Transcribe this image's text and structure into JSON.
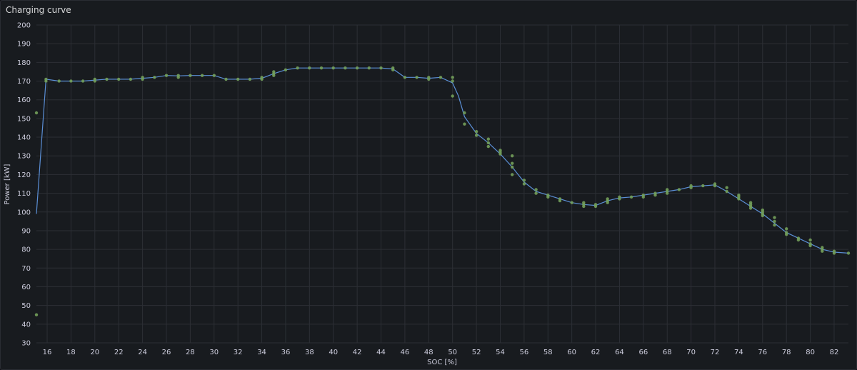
{
  "panel": {
    "title": "Charging curve"
  },
  "colors": {
    "line": "#5b8fd6",
    "points": "#73a05a",
    "grid": "#2c2f35",
    "text": "#ccccdc"
  },
  "chart_data": {
    "type": "scatter",
    "title": "Charging curve",
    "xlabel": "SOC [%]",
    "ylabel": "Power [kW]",
    "xlim": [
      15.1,
      83.2
    ],
    "ylim": [
      30,
      200
    ],
    "xticks": [
      16,
      18,
      20,
      22,
      24,
      26,
      28,
      30,
      32,
      34,
      36,
      38,
      40,
      42,
      44,
      46,
      48,
      50,
      52,
      54,
      56,
      58,
      60,
      62,
      64,
      66,
      68,
      70,
      72,
      74,
      76,
      78,
      80,
      82
    ],
    "yticks": [
      30,
      40,
      50,
      60,
      70,
      80,
      90,
      100,
      110,
      120,
      130,
      140,
      150,
      160,
      170,
      180,
      190,
      200
    ],
    "grid": true,
    "series": [
      {
        "type": "line",
        "points": [
          [
            15.1,
            99
          ],
          [
            15.9,
            171
          ],
          [
            17,
            170
          ],
          [
            18,
            170
          ],
          [
            19,
            170
          ],
          [
            20,
            170.5
          ],
          [
            21,
            171
          ],
          [
            22,
            171
          ],
          [
            23,
            171
          ],
          [
            24,
            171.5
          ],
          [
            25,
            172
          ],
          [
            26,
            173
          ],
          [
            27,
            172.8
          ],
          [
            28,
            173
          ],
          [
            29,
            173
          ],
          [
            30,
            173
          ],
          [
            31,
            171
          ],
          [
            32,
            171
          ],
          [
            33,
            171
          ],
          [
            34,
            171.5
          ],
          [
            35,
            174
          ],
          [
            36,
            176
          ],
          [
            37,
            177
          ],
          [
            38,
            177
          ],
          [
            39,
            177
          ],
          [
            40,
            177
          ],
          [
            41,
            177
          ],
          [
            42,
            177
          ],
          [
            43,
            177
          ],
          [
            44,
            177
          ],
          [
            45,
            176.5
          ],
          [
            46,
            172
          ],
          [
            47,
            172
          ],
          [
            48,
            171.5
          ],
          [
            49,
            172
          ],
          [
            50,
            169
          ],
          [
            50.5,
            162
          ],
          [
            51,
            151
          ],
          [
            52,
            142
          ],
          [
            53,
            137
          ],
          [
            54,
            131
          ],
          [
            55,
            124
          ],
          [
            56,
            116
          ],
          [
            57,
            111
          ],
          [
            58,
            109
          ],
          [
            59,
            107
          ],
          [
            60,
            105
          ],
          [
            61,
            104
          ],
          [
            62,
            103.5
          ],
          [
            63,
            106
          ],
          [
            64,
            107.5
          ],
          [
            65,
            108
          ],
          [
            66,
            109
          ],
          [
            67,
            110
          ],
          [
            68,
            111
          ],
          [
            69,
            112
          ],
          [
            70,
            113.5
          ],
          [
            71,
            114
          ],
          [
            72,
            114.5
          ],
          [
            73,
            111
          ],
          [
            74,
            107
          ],
          [
            75,
            103
          ],
          [
            76,
            99
          ],
          [
            77,
            94
          ],
          [
            78,
            89
          ],
          [
            79,
            86
          ],
          [
            80,
            83
          ],
          [
            81,
            80
          ],
          [
            82,
            78.5
          ],
          [
            83.2,
            78
          ]
        ]
      },
      {
        "type": "scatter",
        "points": [
          [
            15.1,
            153
          ],
          [
            15.1,
            45
          ],
          [
            15.9,
            171
          ],
          [
            15.9,
            170
          ],
          [
            17,
            170
          ],
          [
            18,
            170
          ],
          [
            19,
            170
          ],
          [
            20,
            171
          ],
          [
            20,
            170
          ],
          [
            21,
            171
          ],
          [
            22,
            171
          ],
          [
            23,
            171
          ],
          [
            24,
            172
          ],
          [
            24,
            171
          ],
          [
            25,
            172
          ],
          [
            26,
            173
          ],
          [
            27,
            173
          ],
          [
            27,
            172
          ],
          [
            28,
            173
          ],
          [
            29,
            173
          ],
          [
            30,
            173
          ],
          [
            31,
            171
          ],
          [
            32,
            171
          ],
          [
            33,
            171
          ],
          [
            34,
            172
          ],
          [
            34,
            171
          ],
          [
            35,
            175
          ],
          [
            35,
            174
          ],
          [
            35,
            173
          ],
          [
            36,
            176
          ],
          [
            37,
            177
          ],
          [
            38,
            177
          ],
          [
            39,
            177
          ],
          [
            40,
            177
          ],
          [
            41,
            177
          ],
          [
            42,
            177
          ],
          [
            43,
            177
          ],
          [
            44,
            177
          ],
          [
            45,
            177
          ],
          [
            45,
            176
          ],
          [
            46,
            172
          ],
          [
            47,
            172
          ],
          [
            48,
            172
          ],
          [
            48,
            171
          ],
          [
            49,
            172
          ],
          [
            50,
            172
          ],
          [
            50,
            170
          ],
          [
            50,
            162
          ],
          [
            51,
            153
          ],
          [
            51,
            147
          ],
          [
            52,
            143
          ],
          [
            52,
            141
          ],
          [
            53,
            139
          ],
          [
            53,
            137
          ],
          [
            53,
            135
          ],
          [
            54,
            133
          ],
          [
            54,
            131
          ],
          [
            54,
            132
          ],
          [
            55,
            130
          ],
          [
            55,
            126
          ],
          [
            55,
            124
          ],
          [
            55,
            120
          ],
          [
            56,
            117
          ],
          [
            56,
            115
          ],
          [
            57,
            112
          ],
          [
            57,
            110
          ],
          [
            58,
            109
          ],
          [
            58,
            108
          ],
          [
            59,
            107
          ],
          [
            59,
            106
          ],
          [
            60,
            105
          ],
          [
            61,
            105
          ],
          [
            61,
            104
          ],
          [
            61,
            103
          ],
          [
            62,
            104
          ],
          [
            62,
            103
          ],
          [
            63,
            107
          ],
          [
            63,
            106
          ],
          [
            63,
            105
          ],
          [
            64,
            108
          ],
          [
            64,
            107
          ],
          [
            65,
            108
          ],
          [
            66,
            109
          ],
          [
            66,
            108
          ],
          [
            67,
            110
          ],
          [
            67,
            109
          ],
          [
            68,
            112
          ],
          [
            68,
            111
          ],
          [
            68,
            110
          ],
          [
            69,
            112
          ],
          [
            70,
            114
          ],
          [
            70,
            113
          ],
          [
            71,
            114
          ],
          [
            72,
            115
          ],
          [
            72,
            114
          ],
          [
            73,
            113
          ],
          [
            73,
            111
          ],
          [
            74,
            109
          ],
          [
            74,
            108
          ],
          [
            74,
            107
          ],
          [
            75,
            105
          ],
          [
            75,
            103
          ],
          [
            75,
            102
          ],
          [
            75,
            104
          ],
          [
            76,
            101
          ],
          [
            76,
            99
          ],
          [
            76,
            98
          ],
          [
            76,
            100
          ],
          [
            77,
            97
          ],
          [
            77,
            95
          ],
          [
            77,
            93
          ],
          [
            78,
            91
          ],
          [
            78,
            89
          ],
          [
            78,
            88
          ],
          [
            79,
            86
          ],
          [
            79,
            85
          ],
          [
            80,
            85
          ],
          [
            80,
            83
          ],
          [
            80,
            82
          ],
          [
            81,
            81
          ],
          [
            81,
            80
          ],
          [
            81,
            79
          ],
          [
            82,
            79
          ],
          [
            82,
            78
          ],
          [
            83.2,
            78
          ]
        ]
      }
    ]
  }
}
